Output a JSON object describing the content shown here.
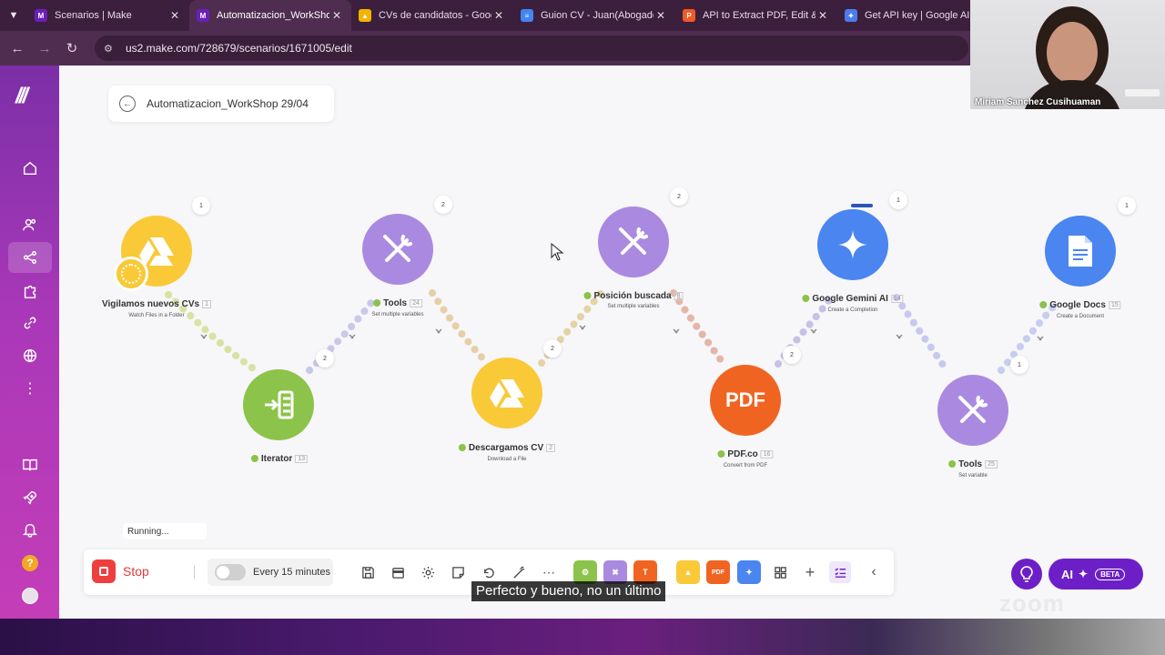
{
  "browser": {
    "tabs": [
      {
        "title": "Scenarios | Make",
        "favicon": "make-icon",
        "color": "#6b1fb8",
        "active": false
      },
      {
        "title": "Automatizacion_WorkShop",
        "favicon": "make-icon",
        "color": "#6b1fb8",
        "active": true
      },
      {
        "title": "CVs de candidatos - Goog",
        "favicon": "google-drive-icon",
        "color": "#f4b400",
        "active": false
      },
      {
        "title": "Guion CV - Juan(Abogado)",
        "favicon": "google-docs-icon",
        "color": "#4285f4",
        "active": false
      },
      {
        "title": "API to Extract PDF, Edit & C",
        "favicon": "pdf-co-icon",
        "color": "#f15a24",
        "active": false
      },
      {
        "title": "Get API key | Google AI St",
        "favicon": "google-ai-studio-icon",
        "color": "#4b7bec",
        "active": false
      }
    ],
    "url": "us2.make.com/728679/scenarios/1671005/edit"
  },
  "scenario": {
    "title": "Automatizacion_WorkShop 29/04",
    "status": "Running..."
  },
  "modules": [
    {
      "name": "Vigilamos nuevos CVs",
      "num": "1",
      "sub": "Watch Files in a Folder",
      "badge": "1",
      "color": "#f9c938",
      "icon": "google-drive-icon"
    },
    {
      "name": "Iterator",
      "num": "13",
      "sub": "",
      "badge": "2",
      "color": "#8cc34a",
      "icon": "iterator-icon"
    },
    {
      "name": "Tools",
      "num": "24",
      "sub": "Set multiple variables",
      "badge": "2",
      "color": "#a98ae0",
      "icon": "tools-icon"
    },
    {
      "name": "Descargamos CV",
      "num": "2",
      "sub": "Download a File",
      "badge": "2",
      "color": "#f9c938",
      "icon": "google-drive-icon"
    },
    {
      "name": "Posición buscada",
      "num": "8",
      "sub": "Set multiple variables",
      "badge": "2",
      "color": "#a98ae0",
      "icon": "tools-icon"
    },
    {
      "name": "PDF.co",
      "num": "16",
      "sub": "Convert from PDF",
      "badge": "2",
      "color": "#f06422",
      "icon": "pdf-icon",
      "glyph": "PDF"
    },
    {
      "name": "Google Gemini AI",
      "num": "14",
      "sub": "Create a Completion",
      "badge": "1",
      "color": "#4a85f0",
      "icon": "gemini-icon"
    },
    {
      "name": "Tools",
      "num": "25",
      "sub": "Set variable",
      "badge": "1",
      "color": "#a98ae0",
      "icon": "tools-icon"
    },
    {
      "name": "Google Docs",
      "num": "15",
      "sub": "Create a Document",
      "badge": "1",
      "color": "#4a85f0",
      "icon": "google-docs-icon"
    }
  ],
  "toolbar": {
    "stop_label": "Stop",
    "schedule_label": "Every 15 minutes",
    "app_colors": [
      "#8cc34a",
      "#a98ae0",
      "#f06422",
      "#f9c938",
      "#f06422",
      "#4a85f0"
    ],
    "app_labels": [
      "",
      "",
      "",
      "",
      "PDF",
      ""
    ]
  },
  "ai": {
    "label": "AI",
    "badge": "BETA"
  },
  "subtitle": "Perfecto y bueno, no un último",
  "zoom_watermark": "zoom",
  "webcam": {
    "name": "Miriam Sanchez Cusihuaman"
  }
}
